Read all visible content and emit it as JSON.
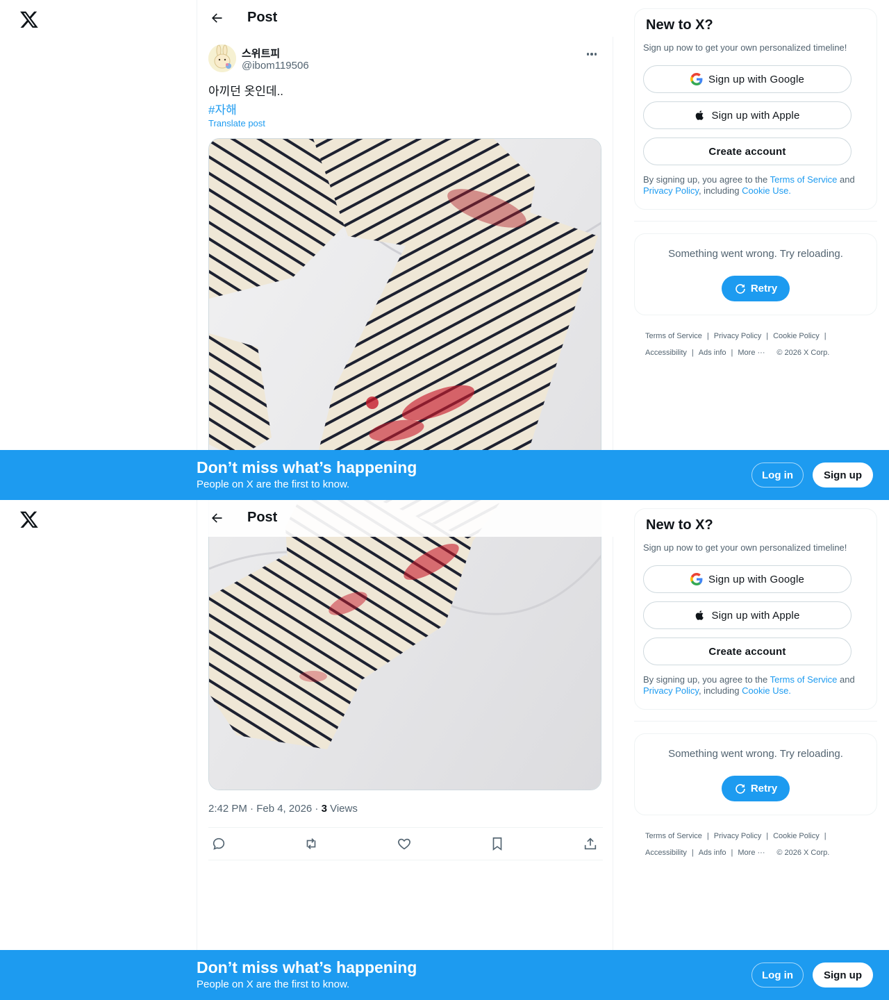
{
  "header": {
    "title": "Post"
  },
  "post": {
    "display_name": "스위트피",
    "handle": "@ibom119506",
    "text": "아끼던 옷인데..",
    "hashtag": "#자해",
    "translate_label": "Translate post",
    "time": "2:42 PM · Feb 4, 2026 · ",
    "views_count": "3",
    "views_label": " Views"
  },
  "sidebar": {
    "title": "New to X?",
    "subtitle": "Sign up now to get your own personalized timeline!",
    "google_label": "Sign up with Google",
    "apple_label": "Sign up with Apple",
    "create_label": "Create account",
    "legal_prefix": "By signing up, you agree to the ",
    "terms_link": "Terms of Service",
    "legal_and": " and ",
    "privacy_link": "Privacy Policy",
    "legal_including": ", including ",
    "cookie_link": "Cookie Use.",
    "error_text": "Something went wrong. Try reloading.",
    "retry_label": "Retry"
  },
  "footer": {
    "links": [
      "Terms of Service",
      "Privacy Policy",
      "Cookie Policy",
      "Accessibility",
      "Ads info",
      "More ···",
      "© 2026 X Corp."
    ]
  },
  "banner": {
    "title": "Don’t miss what’s happening",
    "subtitle": "People on X are the first to know.",
    "login_label": "Log in",
    "signup_label": "Sign up"
  },
  "colors": {
    "accent": "#1d9bf0",
    "text": "#0f1419",
    "muted": "#536471",
    "border": "#eff3f4"
  },
  "icons": [
    "x-logo-icon",
    "back-arrow-icon",
    "more-icon",
    "reply-icon",
    "repost-icon",
    "like-icon",
    "bookmark-icon",
    "share-icon",
    "google-icon",
    "apple-icon",
    "refresh-icon"
  ]
}
